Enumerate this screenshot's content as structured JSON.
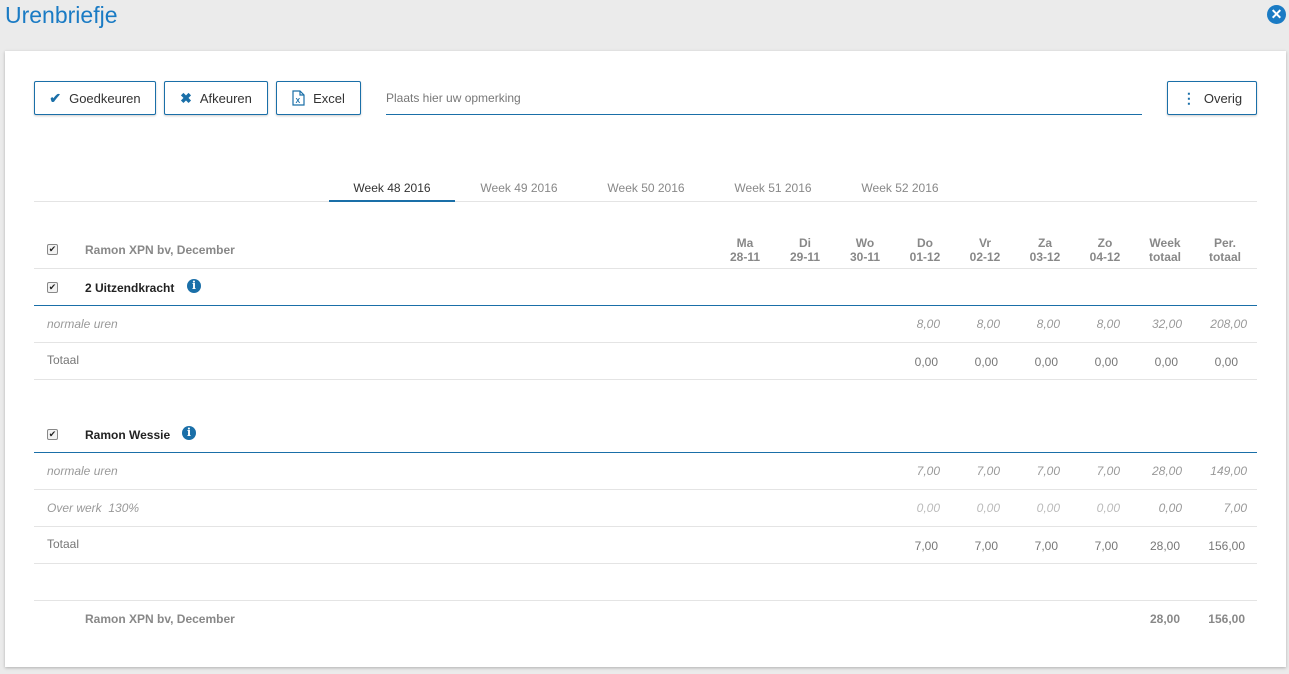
{
  "window": {
    "title": "Urenbriefje"
  },
  "toolbar": {
    "approve_label": "Goedkeuren",
    "reject_label": "Afkeuren",
    "excel_label": "Excel",
    "remark_placeholder": "Plaats hier uw opmerking",
    "more_label": "Overig"
  },
  "tabs": [
    {
      "label": "Week 48 2016",
      "active": true
    },
    {
      "label": "Week 49 2016",
      "active": false
    },
    {
      "label": "Week 50 2016",
      "active": false
    },
    {
      "label": "Week 51 2016",
      "active": false
    },
    {
      "label": "Week 52 2016",
      "active": false
    }
  ],
  "header": {
    "label": "Ramon XPN bv, December",
    "columns": [
      {
        "day": "Ma",
        "date": "28-11"
      },
      {
        "day": "Di",
        "date": "29-11"
      },
      {
        "day": "Wo",
        "date": "30-11"
      },
      {
        "day": "Do",
        "date": "01-12"
      },
      {
        "day": "Vr",
        "date": "02-12"
      },
      {
        "day": "Za",
        "date": "03-12"
      },
      {
        "day": "Zo",
        "date": "04-12"
      },
      {
        "day": "Week",
        "date": "totaal"
      },
      {
        "day": "Per.",
        "date": "totaal"
      }
    ]
  },
  "groups": [
    {
      "name": "2 Uitzendkracht",
      "rows": [
        {
          "label": "normale uren",
          "values": [
            "",
            "",
            "",
            "8,00",
            "8,00",
            "8,00",
            "8,00",
            "32,00",
            "208,00"
          ]
        },
        {
          "label": "Totaal",
          "values": [
            "",
            "",
            "",
            "0,00",
            "0,00",
            "0,00",
            "0,00",
            "0,00",
            "0,00"
          ]
        }
      ]
    },
    {
      "name": "Ramon Wessie",
      "rows": [
        {
          "label": "normale uren",
          "values": [
            "",
            "",
            "",
            "7,00",
            "7,00",
            "7,00",
            "7,00",
            "28,00",
            "149,00"
          ]
        },
        {
          "label": "Over werk  130%",
          "values": [
            "",
            "",
            "",
            "0,00",
            "0,00",
            "0,00",
            "0,00",
            "0,00",
            "7,00"
          ]
        },
        {
          "label": "Totaal",
          "values": [
            "",
            "",
            "",
            "7,00",
            "7,00",
            "7,00",
            "7,00",
            "28,00",
            "156,00"
          ]
        }
      ]
    }
  ],
  "footer": {
    "label": "Ramon XPN bv, December",
    "week_total": "28,00",
    "period_total": "156,00"
  },
  "colors": {
    "accent": "#1a7bc4",
    "border_blue": "#1a6fa8"
  }
}
